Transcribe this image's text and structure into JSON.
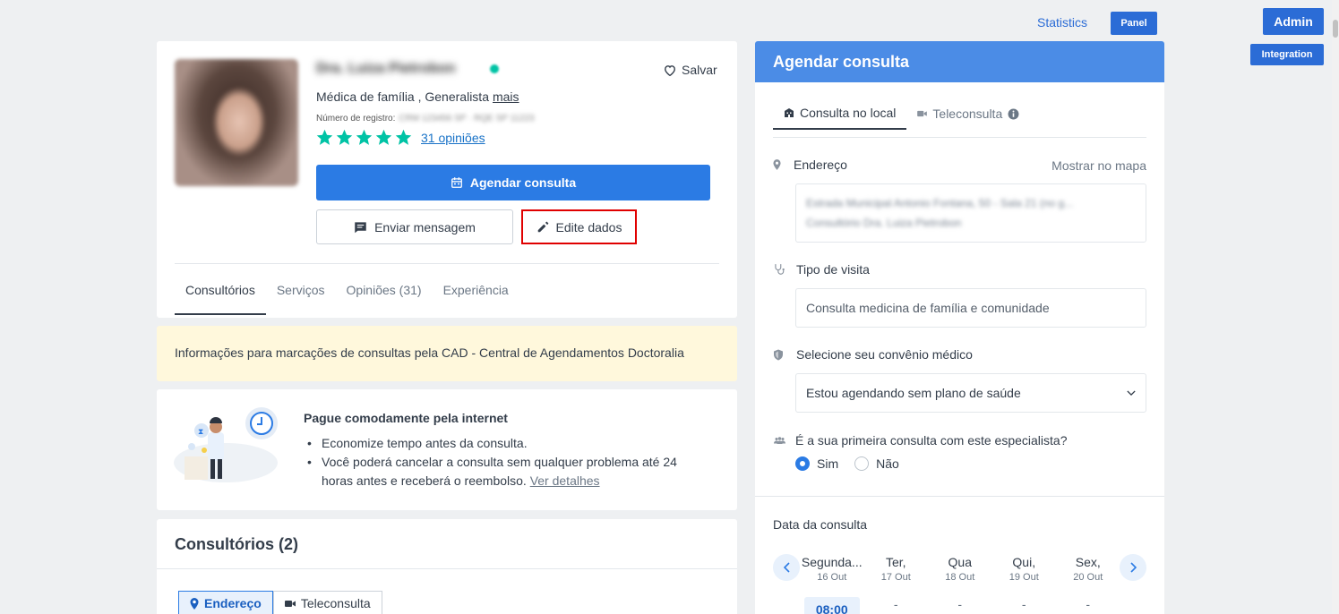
{
  "admin": {
    "statistics": "Statistics",
    "panel": "Panel",
    "admin": "Admin",
    "integration": "Integration"
  },
  "profile": {
    "name": "Dra. Luiza Pietrobon",
    "save": "Salvar",
    "specialty": "Médica de família , Generalista",
    "more": "mais",
    "registration_label": "Número de registro:",
    "registration_value": "CRM 123456 SP · RQE SP 11223",
    "rating_stars": 5,
    "opinions": "31 opiniões",
    "book_button": "Agendar consulta",
    "message_button": "Enviar mensagem",
    "edit_button": "Edite dados",
    "tabs": [
      "Consultórios",
      "Serviços",
      "Opiniões (31)",
      "Experiência"
    ]
  },
  "notice": "Informações para marcações de consultas pela CAD - Central de Agendamentos Doctoralia",
  "payment": {
    "title": "Pague comodamente pela internet",
    "items": [
      "Economize tempo antes da consulta.",
      "Você poderá cancelar a consulta sem qualquer problema até 24 horas antes e receberá o reembolso."
    ],
    "details_link": "Ver detalhes"
  },
  "offices": {
    "title": "Consultórios (2)",
    "tabs": [
      "Endereço",
      "Teleconsulta"
    ]
  },
  "booking": {
    "header": "Agendar consulta",
    "tabs": [
      "Consulta no local",
      "Teleconsulta"
    ],
    "address_label": "Endereço",
    "map_link": "Mostrar no mapa",
    "address_line1": "Estrada Municipal Antonio Fontana, 50 - Sala 21 (no g...",
    "address_line2": "Consultório Dra. Luiza Pietrobon",
    "visit_label": "Tipo de visita",
    "visit_value": "Consulta medicina de família e comunidade",
    "insurance_label": "Selecione seu convênio médico",
    "insurance_value": "Estou agendando sem plano de saúde",
    "first_label": "É a sua primeira consulta com este especialista?",
    "yes": "Sim",
    "no": "Não",
    "date_label": "Data da consulta",
    "days": [
      {
        "name": "Segunda...",
        "date": "16 Out"
      },
      {
        "name": "Ter,",
        "date": "17 Out"
      },
      {
        "name": "Qua",
        "date": "18 Out"
      },
      {
        "name": "Qui,",
        "date": "19 Out"
      },
      {
        "name": "Sex,",
        "date": "20 Out"
      }
    ],
    "slots": [
      "08:00",
      "-",
      "-",
      "-",
      "-"
    ]
  },
  "colors": {
    "primary": "#2b7be4",
    "header": "#4b8ce6",
    "star": "#00c3a5",
    "notice_bg": "#fff8dc",
    "highlight": "#e00000"
  }
}
